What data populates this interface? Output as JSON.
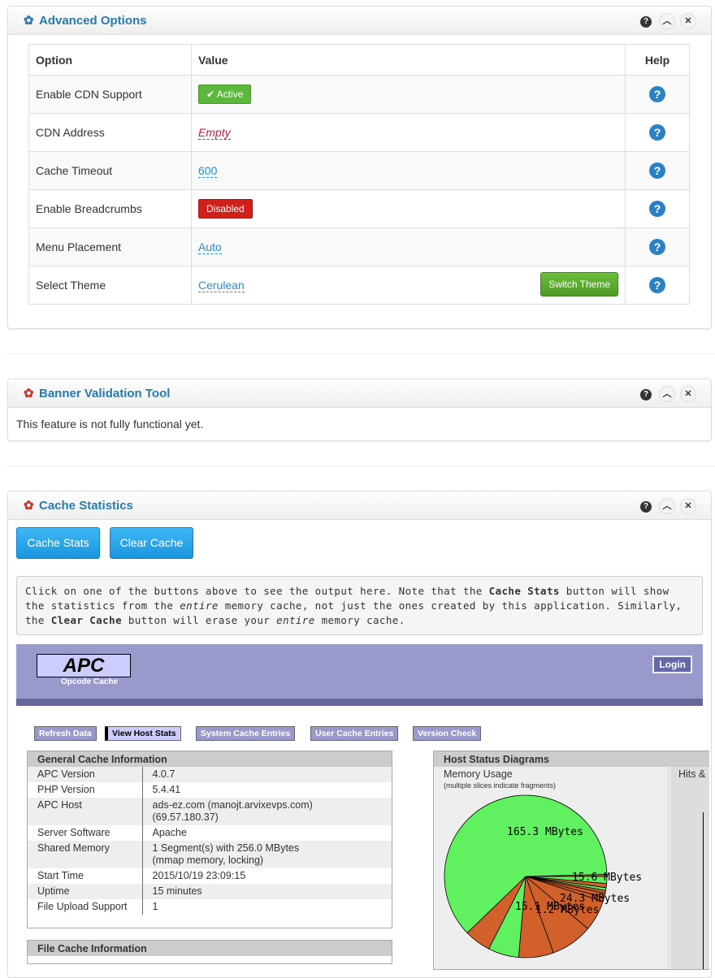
{
  "advanced": {
    "title": "Advanced Options",
    "headers": {
      "option": "Option",
      "value": "Value",
      "help": "Help"
    },
    "rows": [
      {
        "option": "Enable CDN Support",
        "value": "Active",
        "type": "active"
      },
      {
        "option": "CDN Address",
        "value": "Empty",
        "type": "empty"
      },
      {
        "option": "Cache Timeout",
        "value": "600",
        "type": "editable"
      },
      {
        "option": "Enable Breadcrumbs",
        "value": "Disabled",
        "type": "disabled"
      },
      {
        "option": "Menu Placement",
        "value": "Auto",
        "type": "editable"
      },
      {
        "option": "Select Theme",
        "value": "Cerulean",
        "type": "editable"
      }
    ],
    "switch_theme": "Switch Theme"
  },
  "banner": {
    "title": "Banner Validation Tool",
    "message": "This feature is not fully functional yet."
  },
  "cache": {
    "title": "Cache Statistics",
    "stats_btn": "Cache Stats",
    "clear_btn": "Clear Cache",
    "note_1": "Click on one of the buttons above to see the output here. Note that the ",
    "note_b1": "Cache Stats",
    "note_2": " button will show the statistics from the ",
    "note_i1": "entire",
    "note_3": " memory cache, not just the ones created by this application. Similarly, the ",
    "note_b2": "Clear Cache",
    "note_4": " button will erase your ",
    "note_i2": "entire",
    "note_5": " memory cache."
  },
  "apc": {
    "logo": "APC",
    "logo_sub": "Opcode Cache",
    "login": "Login",
    "tabs": [
      "Refresh Data",
      "View Host Stats",
      "System Cache Entries",
      "User Cache Entries",
      "Version Check"
    ],
    "general_title": "General Cache Information",
    "general": [
      {
        "k": "APC Version",
        "v": "4.0.7"
      },
      {
        "k": "PHP Version",
        "v": "5.4.41"
      },
      {
        "k": "APC Host",
        "v": "ads-ez.com (manojt.arvixevps.com)\n(69.57.180.37)"
      },
      {
        "k": "Server Software",
        "v": "Apache"
      },
      {
        "k": "Shared Memory",
        "v": "1 Segment(s) with 256.0 MBytes\n(mmap memory, locking)"
      },
      {
        "k": "Start Time",
        "v": "2015/10/19 23:09:15"
      },
      {
        "k": "Uptime",
        "v": "15 minutes"
      },
      {
        "k": "File Upload Support",
        "v": "1"
      }
    ],
    "file_title": "File Cache Information",
    "diagrams_title": "Host Status Diagrams",
    "memory_usage": "Memory Usage",
    "memory_note": "(multiple slices indicate fragments)",
    "hits_label": "Hits &",
    "pie_labels": [
      "165.3 MBytes",
      "15.6 MBytes",
      "24.3 MBytes",
      "15.1 MBytes",
      "1.2 MBytes"
    ],
    "colors": {
      "free": "#60f060",
      "used": "#d2602a"
    }
  }
}
